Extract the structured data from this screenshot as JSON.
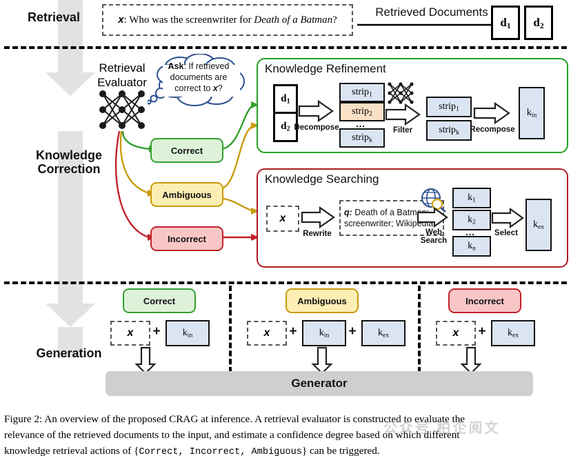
{
  "stages": {
    "retrieval": "Retrieval",
    "knowledge_correction_l1": "Knowledge",
    "knowledge_correction_l2": "Correction",
    "generation": "Generation"
  },
  "retrieval": {
    "query_prefix": "x",
    "query_colon": ": Who was the screenwriter for ",
    "query_italic": "Death of a Batman",
    "query_suffix": "?",
    "arrow_label": "Retrieved Documents",
    "docs": [
      {
        "base": "d",
        "sub": "1"
      },
      {
        "base": "d",
        "sub": "2"
      }
    ]
  },
  "evaluator": {
    "title_l1": "Retrieval",
    "title_l2": "Evaluator",
    "bubble_l1_bold": "Ask",
    "bubble_l1_rest": ": If retrieved",
    "bubble_l2": "documents are",
    "bubble_l3_pre": "correct to ",
    "bubble_l3_x": "x",
    "bubble_l3_post": "?"
  },
  "decisions": [
    {
      "label": "Correct",
      "color": "#33a02c"
    },
    {
      "label": "Ambiguous",
      "color": "#c99a0a"
    },
    {
      "label": "Incorrect",
      "color": "#c0212a"
    }
  ],
  "refinement": {
    "title": "Knowledge Refinement",
    "border_color": "#21a121",
    "inputs": [
      {
        "base": "d",
        "sub": "1"
      },
      {
        "base": "d",
        "sub": "2"
      }
    ],
    "op_decompose": "Decompose",
    "strips_all": [
      {
        "base": "strip",
        "sub": "1",
        "highlight": false
      },
      {
        "base": "strip",
        "sub": "2",
        "highlight": true
      },
      {
        "base": "strip",
        "sub": "k",
        "highlight": false
      }
    ],
    "ellipsis": "...",
    "op_filter": "Filter",
    "strips_kept": [
      {
        "base": "strip",
        "sub": "1"
      },
      {
        "base": "strip",
        "sub": "k"
      }
    ],
    "op_recompose": "Recompose",
    "output": {
      "base": "k",
      "sub": "in"
    }
  },
  "searching": {
    "title": "Knowledge Searching",
    "border_color": "#b01b24",
    "input_x": "x",
    "op_rewrite": "Rewrite",
    "query_label": "q:",
    "query_line1": " Death of a Batman;",
    "query_line2": "screenwriter; Wikipedia",
    "op_websearch_l1": "Web",
    "op_websearch_l2": "Search",
    "results": [
      {
        "base": "k",
        "sub": "1"
      },
      {
        "base": "k",
        "sub": "2"
      },
      {
        "base": "k",
        "sub": "n"
      }
    ],
    "ellipsis": "...",
    "op_select": "Select",
    "output": {
      "base": "k",
      "sub": "ex"
    },
    "icon": "globe-search-icon"
  },
  "generation": {
    "columns": [
      {
        "pill": "Correct",
        "pill_style": "correct",
        "terms": [
          {
            "type": "query",
            "text": "x"
          },
          {
            "type": "knowledge",
            "base": "k",
            "sub": "in"
          }
        ]
      },
      {
        "pill": "Ambiguous",
        "pill_style": "ambig",
        "terms": [
          {
            "type": "query",
            "text": "x"
          },
          {
            "type": "knowledge",
            "base": "k",
            "sub": "in"
          },
          {
            "type": "knowledge",
            "base": "k",
            "sub": "ex"
          }
        ]
      },
      {
        "pill": "Incorrect",
        "pill_style": "incorrect",
        "terms": [
          {
            "type": "query",
            "text": "x"
          },
          {
            "type": "knowledge",
            "base": "k",
            "sub": "ex"
          }
        ]
      }
    ],
    "plus": "+",
    "generator_label": "Generator"
  },
  "caption": {
    "line1": "Figure 2: An overview of the proposed CRAG at inference.  A retrieval evaluator is constructed to evaluate the",
    "line2": "relevance of the retrieved documents to the input, and estimate a confidence degree based on which different",
    "line3_pre": "knowledge retrieval actions of {",
    "line3_mono": "Correct, Incorrect, Ambiguous",
    "line3_post": "} can be triggered."
  },
  "watermark": "公众号 柏企阅文"
}
